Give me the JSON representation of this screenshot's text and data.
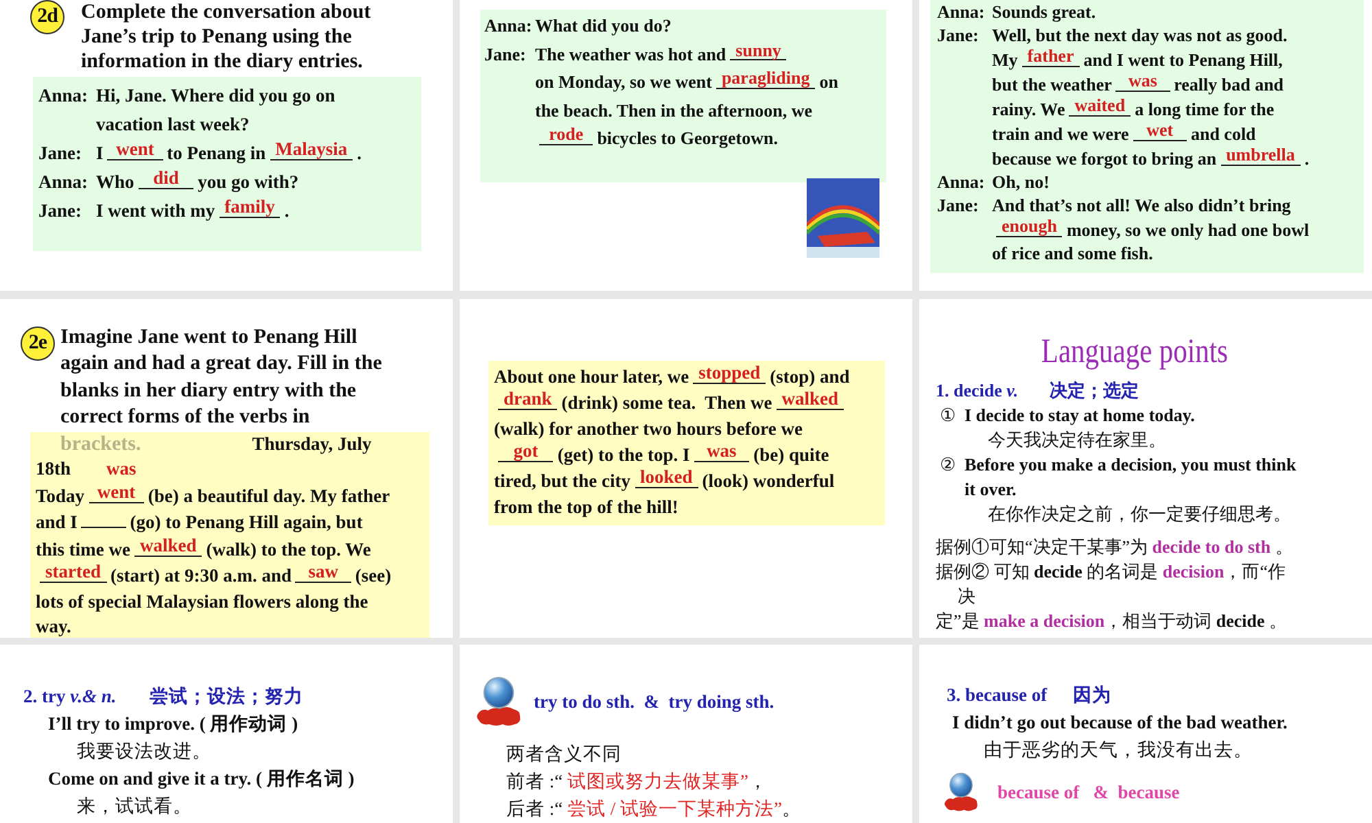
{
  "slides": [
    {
      "kind": "dialogue",
      "badge": "2d",
      "instruction": [
        "Complete the conversation about",
        "Jane’s trip to Penang using the",
        "information in the diary entries."
      ],
      "turns": [
        {
          "speaker": "Anna:",
          "lines": [
            [
              {
                "kind": "text",
                "text": "Hi, Jane. Where did you go on"
              }
            ],
            [
              {
                "kind": "text",
                "text": "vacation last week?"
              }
            ]
          ]
        },
        {
          "speaker": "Jane:",
          "lines": [
            [
              {
                "kind": "text",
                "text": "I"
              },
              {
                "kind": "blank",
                "answer": "went"
              },
              {
                "kind": "text",
                "text": "to Penang in"
              },
              {
                "kind": "blank",
                "answer": "Malaysia"
              },
              {
                "kind": "text",
                "text": "."
              }
            ]
          ]
        },
        {
          "speaker": "Anna:",
          "lines": [
            [
              {
                "kind": "text",
                "text": "Who"
              },
              {
                "kind": "blank",
                "answer": "did"
              },
              {
                "kind": "text",
                "text": "you go with?"
              }
            ]
          ]
        },
        {
          "speaker": "Jane:",
          "lines": [
            [
              {
                "kind": "text",
                "text": "I went with my"
              },
              {
                "kind": "blank",
                "answer": "family"
              },
              {
                "kind": "text",
                "text": "."
              }
            ]
          ]
        }
      ]
    },
    {
      "kind": "dialogue",
      "picture": true,
      "turns": [
        {
          "speaker": "Anna:",
          "lines": [
            [
              {
                "kind": "text",
                "text": "What did you do?"
              }
            ]
          ]
        },
        {
          "speaker": "Jane:",
          "lines": [
            [
              {
                "kind": "text",
                "text": "The weather was hot and"
              },
              {
                "kind": "blank",
                "answer": "sunny"
              }
            ],
            [
              {
                "kind": "text",
                "text": "on Monday, so we went"
              },
              {
                "kind": "blank",
                "answer": "paragliding"
              },
              {
                "kind": "text",
                "text": "on"
              }
            ],
            [
              {
                "kind": "text",
                "text": "the beach. Then in the afternoon, we"
              }
            ],
            [
              {
                "kind": "blank",
                "answer": "rode"
              },
              {
                "kind": "text",
                "text": "bicycles to Georgetown."
              }
            ]
          ]
        }
      ]
    },
    {
      "kind": "dialogue",
      "turns": [
        {
          "speaker": "Anna:",
          "lines": [
            [
              {
                "kind": "text",
                "text": "Sounds great."
              }
            ]
          ]
        },
        {
          "speaker": "Jane:",
          "lines": [
            [
              {
                "kind": "text",
                "text": "Well, but the next day was not as good."
              }
            ],
            [
              {
                "kind": "text",
                "text": "My"
              },
              {
                "kind": "blank",
                "answer": "father"
              },
              {
                "kind": "text",
                "text": "and I went to Penang Hill,"
              }
            ],
            [
              {
                "kind": "text",
                "text": "but the weather"
              },
              {
                "kind": "blank",
                "answer": "was"
              },
              {
                "kind": "text",
                "text": "really bad and"
              }
            ],
            [
              {
                "kind": "text",
                "text": "rainy. We"
              },
              {
                "kind": "blank",
                "answer": "waited"
              },
              {
                "kind": "text",
                "text": "a long time for the"
              }
            ],
            [
              {
                "kind": "text",
                "text": "train and we were"
              },
              {
                "kind": "blank",
                "answer": "wet"
              },
              {
                "kind": "text",
                "text": "and cold"
              }
            ],
            [
              {
                "kind": "text",
                "text": "because we forgot to bring an"
              },
              {
                "kind": "blank",
                "answer": "umbrella"
              },
              {
                "kind": "text",
                "text": "."
              }
            ]
          ]
        },
        {
          "speaker": "Anna:",
          "lines": [
            [
              {
                "kind": "text",
                "text": "Oh, no!"
              }
            ]
          ]
        },
        {
          "speaker": "Jane:",
          "lines": [
            [
              {
                "kind": "text",
                "text": "And that’s not all! We also didn’t bring"
              }
            ],
            [
              {
                "kind": "blank",
                "answer": "enough"
              },
              {
                "kind": "text",
                "text": "money, so we only had one bowl"
              }
            ],
            [
              {
                "kind": "text",
                "text": "of rice and some fish."
              }
            ]
          ]
        }
      ]
    },
    {
      "kind": "diary",
      "badge": "2e",
      "instruction": [
        "Imagine Jane went to Penang Hill",
        "again and had a great day. Fill in the",
        "blanks in her diary entry with the",
        "correct forms of the verbs in"
      ],
      "instruction_end": "brackets.",
      "date": [
        "Thursday, July",
        "18th"
      ],
      "floating_answer": "was",
      "lines": [
        [
          {
            "kind": "text",
            "text": "Today"
          },
          {
            "kind": "blank",
            "answer": "went"
          },
          {
            "kind": "text",
            "text": "(be) a beautiful day. My father"
          }
        ],
        [
          {
            "kind": "text",
            "text": "and I"
          },
          {
            "kind": "blank"
          },
          {
            "kind": "text",
            "text": "(go) to Penang Hill again, but"
          }
        ],
        [
          {
            "kind": "text",
            "text": "this time we"
          },
          {
            "kind": "blank",
            "answer": "walked"
          },
          {
            "kind": "text",
            "text": "(walk) to the top. We"
          }
        ],
        [
          {
            "kind": "blank",
            "answer": "started"
          },
          {
            "kind": "text",
            "text": "(start) at 9:30 a.m. and"
          },
          {
            "kind": "blank",
            "answer": "saw"
          },
          {
            "kind": "text",
            "text": "(see)"
          }
        ],
        [
          {
            "kind": "text",
            "text": "lots of special Malaysian flowers along the"
          }
        ],
        [
          {
            "kind": "text",
            "text": "way."
          }
        ]
      ]
    },
    {
      "kind": "diary",
      "lines": [
        [
          {
            "kind": "text",
            "text": "About one hour later, we"
          },
          {
            "kind": "blank",
            "answer": "stopped"
          },
          {
            "kind": "text",
            "text": "(stop) and"
          }
        ],
        [
          {
            "kind": "blank",
            "answer": "drank"
          },
          {
            "kind": "text",
            "text": "(drink) some tea.  Then we"
          },
          {
            "kind": "blank",
            "answer": "walked"
          }
        ],
        [
          {
            "kind": "text",
            "text": "(walk) for another two hours before we"
          }
        ],
        [
          {
            "kind": "blank",
            "answer": "got"
          },
          {
            "kind": "text",
            "text": "(get) to the top. I"
          },
          {
            "kind": "blank",
            "answer": "was"
          },
          {
            "kind": "text",
            "text": "(be) quite"
          }
        ],
        [
          {
            "kind": "text",
            "text": "tired, but the city"
          },
          {
            "kind": "blank",
            "answer": "looked"
          },
          {
            "kind": "text",
            "text": "(look) wonderful"
          }
        ],
        [
          {
            "kind": "text",
            "text": "from the top of the hill!"
          }
        ]
      ]
    },
    {
      "kind": "notes",
      "title": "Language points",
      "entries": [
        {
          "term": "1. decide *v.*",
          "meaning": "决定；选定",
          "examples": [
            {
              "marker": "①",
              "lines": [
                "I decide to stay at home today."
              ],
              "translation": "今天我决定待在家里。"
            },
            {
              "marker": "②",
              "lines": [
                "Before you make a decision, you must think",
                "it over."
              ],
              "translation": "在你作决定之前，你一定要仔细思考。"
            }
          ],
          "notes": [
            {
              "lines": [
                [
                  {
                    "kind": "plain",
                    "text": "据例①可知“决定干某事”为 "
                  },
                  {
                    "kind": "key",
                    "text": "decide to do sth"
                  },
                  {
                    "kind": "plain",
                    "text": " 。"
                  }
                ]
              ]
            },
            {
              "lines": [
                [
                  {
                    "kind": "plain",
                    "text": "据例② 可知 **decide** 的名词是 "
                  },
                  {
                    "kind": "key",
                    "text": "decision"
                  },
                  {
                    "kind": "plain",
                    "text": "，而“作"
                  }
                ],
                [
                  {
                    "kind": "plain",
                    "text": "决"
                  }
                ]
              ]
            },
            {
              "lines": [
                [
                  {
                    "kind": "plain",
                    "text": "定”是 "
                  },
                  {
                    "kind": "key",
                    "text": "make a decision"
                  },
                  {
                    "kind": "plain",
                    "text": "，相当于动词 **decide** 。"
                  }
                ]
              ]
            }
          ]
        }
      ]
    },
    {
      "kind": "notes",
      "entries": [
        {
          "term": "2. try *v.& n.*",
          "meaning": "尝试；设法；努力",
          "examples": [
            {
              "lines": [
                "I’ll try to improve. ( 用作动词 )"
              ],
              "translation": "我要设法改进。"
            },
            {
              "lines": [
                "Come on and give it a try. ( 用作名词 )"
              ],
              "translation": "来，试试看。"
            }
          ]
        }
      ]
    },
    {
      "kind": "comparison",
      "heading": "try to do sth.  &  try doing sth.",
      "lines": [
        [
          {
            "kind": "plain",
            "text": "两者含义不同"
          }
        ],
        [
          {
            "kind": "plain",
            "text": "前者 :“ "
          },
          {
            "kind": "gloss",
            "text": "试图或努力去做某事”"
          },
          {
            "kind": "plain",
            "text": "，"
          }
        ],
        [
          {
            "kind": "plain",
            "text": "后者 :“ "
          },
          {
            "kind": "gloss",
            "text": "尝试 / 试验一下某种方法”"
          },
          {
            "kind": "plain",
            "text": "。"
          }
        ]
      ]
    },
    {
      "kind": "notes",
      "entries": [
        {
          "term": "3. because of",
          "meaning": "因为",
          "examples": [
            {
              "lines": [
                "I didn’t go out because of the bad weather."
              ],
              "translation": "由于恶劣的天气，我没有出去。"
            }
          ]
        }
      ],
      "comparison": {
        "heading": "because of   &  because"
      }
    }
  ]
}
